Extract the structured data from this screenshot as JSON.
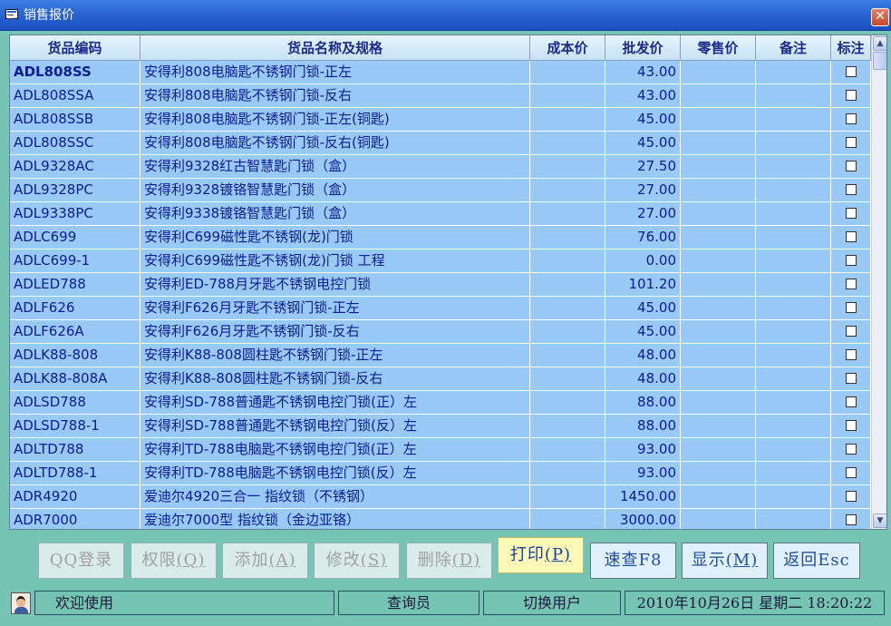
{
  "window": {
    "title": "销售报价"
  },
  "columns": {
    "code": "货品编码",
    "name": "货品名称及规格",
    "cost": "成本价",
    "wholesale": "批发价",
    "retail": "零售价",
    "note": "备注",
    "mark": "标注"
  },
  "rows": [
    {
      "code": "ADL808SS",
      "name": "安得利808电脑匙不锈钢门锁-正左",
      "wholesale": "43.00"
    },
    {
      "code": "ADL808SSA",
      "name": "安得利808电脑匙不锈钢门锁-反右",
      "wholesale": "43.00"
    },
    {
      "code": "ADL808SSB",
      "name": "安得利808电脑匙不锈钢门锁-正左(铜匙)",
      "wholesale": "45.00"
    },
    {
      "code": "ADL808SSC",
      "name": "安得利808电脑匙不锈钢门锁-反右(铜匙)",
      "wholesale": "45.00"
    },
    {
      "code": "ADL9328AC",
      "name": "安得利9328红古智慧匙门锁（盒）",
      "wholesale": "27.50"
    },
    {
      "code": "ADL9328PC",
      "name": "安得利9328镀铬智慧匙门锁（盒）",
      "wholesale": "27.00"
    },
    {
      "code": "ADL9338PC",
      "name": "安得利9338镀铬智慧匙门锁（盒）",
      "wholesale": "27.00"
    },
    {
      "code": "ADLC699",
      "name": "安得利C699磁性匙不锈钢(龙)门锁",
      "wholesale": "76.00"
    },
    {
      "code": "ADLC699-1",
      "name": "安得利C699磁性匙不锈钢(龙)门锁 工程",
      "wholesale": "0.00"
    },
    {
      "code": "ADLED788",
      "name": "安得利ED-788月牙匙不锈钢电控门锁",
      "wholesale": "101.20"
    },
    {
      "code": "ADLF626",
      "name": "安得利F626月牙匙不锈钢门锁-正左",
      "wholesale": "45.00"
    },
    {
      "code": "ADLF626A",
      "name": "安得利F626月牙匙不锈钢门锁-反右",
      "wholesale": "45.00"
    },
    {
      "code": "ADLK88-808",
      "name": "安得利K88-808圆柱匙不锈钢门锁-正左",
      "wholesale": "48.00"
    },
    {
      "code": "ADLK88-808A",
      "name": "安得利K88-808圆柱匙不锈钢门锁-反右",
      "wholesale": "48.00"
    },
    {
      "code": "ADLSD788",
      "name": "安得利SD-788普通匙不锈钢电控门锁(正）左",
      "wholesale": "88.00"
    },
    {
      "code": "ADLSD788-1",
      "name": "安得利SD-788普通匙不锈钢电控门锁(反）左",
      "wholesale": "88.00"
    },
    {
      "code": "ADLTD788",
      "name": "安得利TD-788电脑匙不锈钢电控门锁(正）左",
      "wholesale": "93.00"
    },
    {
      "code": "ADLTD788-1",
      "name": "安得利TD-788电脑匙不锈钢电控门锁(反）左",
      "wholesale": "93.00"
    },
    {
      "code": "ADR4920",
      "name": "爱迪尔4920三合一 指纹锁（不锈钢）",
      "wholesale": "1450.00"
    },
    {
      "code": "ADR7000",
      "name": "爱迪尔7000型 指纹锁（金边亚铬）",
      "wholesale": "3000.00"
    }
  ],
  "buttons": {
    "qq_login": "QQ登录",
    "permission": "权限",
    "permission_key": "(Q)",
    "add": "添加",
    "add_key": "(A)",
    "modify": "修改",
    "modify_key": "(S)",
    "delete": "删除",
    "delete_key": "(D)",
    "print": "打印",
    "print_key": "(P)",
    "quick_search": "速查F8",
    "display": "显示",
    "display_key": "(M)",
    "back": "返回Esc"
  },
  "status": {
    "welcome": "欢迎使用",
    "role": "查询员",
    "switch_user": "切换用户",
    "datetime": "2010年10月26日 星期二 18:20:22"
  }
}
